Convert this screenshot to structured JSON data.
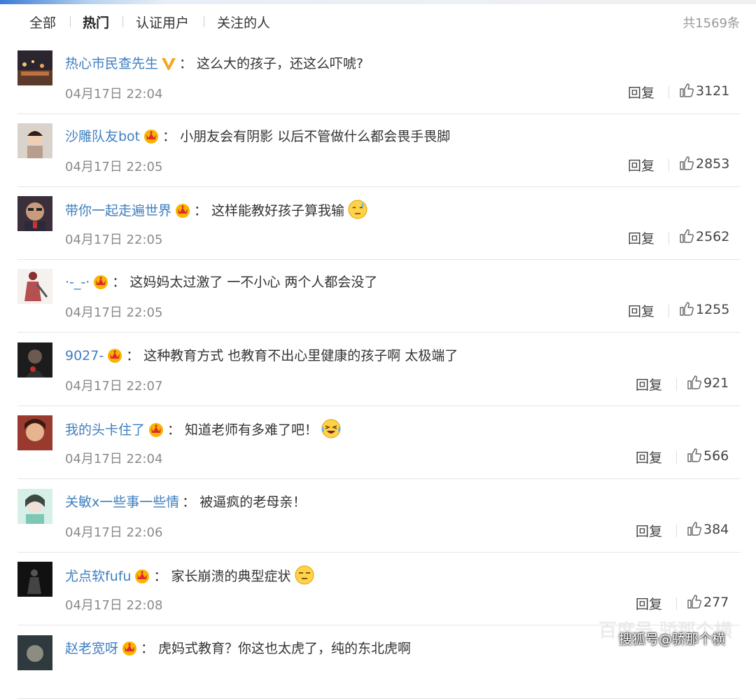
{
  "tabs": [
    {
      "label": "全部"
    },
    {
      "label": "热门"
    },
    {
      "label": "认证用户"
    },
    {
      "label": "关注的人"
    }
  ],
  "total": "共1569条",
  "reply_label": "回复",
  "colon": "：",
  "comments": [
    {
      "user": "热心市民查先生",
      "badge": "verified-v-icon",
      "text": "这么大的孩子，还这么吓唬?",
      "emoji": "",
      "time": "04月17日 22:04",
      "likes": "3121"
    },
    {
      "user": "沙雕队友bot",
      "badge": "crown-member-icon",
      "text": "小朋友会有阴影 以后不管做什么都会畏手畏脚",
      "emoji": "",
      "time": "04月17日 22:05",
      "likes": "2853"
    },
    {
      "user": "带你一起走遍世界",
      "badge": "crown-member-icon",
      "text": "这样能教好孩子算我输",
      "emoji": "sweat-emoji",
      "time": "04月17日 22:05",
      "likes": "2562"
    },
    {
      "user": "·-_-·",
      "badge": "crown-member-icon",
      "text": "这妈妈太过激了 一不小心 两个人都会没了",
      "emoji": "",
      "time": "04月17日 22:05",
      "likes": "1255"
    },
    {
      "user": "9027-",
      "badge": "crown-member-icon",
      "text": "这种教育方式 也教育不出心里健康的孩子啊 太极端了",
      "emoji": "",
      "time": "04月17日 22:07",
      "likes": "921"
    },
    {
      "user": "我的头卡住了",
      "badge": "crown-member-icon",
      "text": "知道老师有多难了吧！",
      "emoji": "laugh-cry-emoji",
      "time": "04月17日 22:04",
      "likes": "566"
    },
    {
      "user": "关敏x一些事一些情",
      "badge": "",
      "text": "被逼疯的老母亲！",
      "emoji": "",
      "time": "04月17日 22:06",
      "likes": "384"
    },
    {
      "user": "尤点软fufu",
      "badge": "crown-member-icon",
      "text": "家长崩溃的典型症状",
      "emoji": "speechless-emoji",
      "time": "04月17日 22:08",
      "likes": "277"
    },
    {
      "user": "赵老宽呀",
      "badge": "crown-member-icon",
      "text": "虎妈式教育？你这也太虎了，纯的东北虎啊",
      "emoji": "",
      "time": "",
      "likes": ""
    }
  ],
  "watermark": "搜狐号@骄那个横",
  "watermark_faint": "百度号 骄那个横",
  "colors": {
    "username": "#3f7fbf",
    "text": "#333333",
    "muted": "#8a8a8a",
    "divider": "#e6e6e6"
  }
}
